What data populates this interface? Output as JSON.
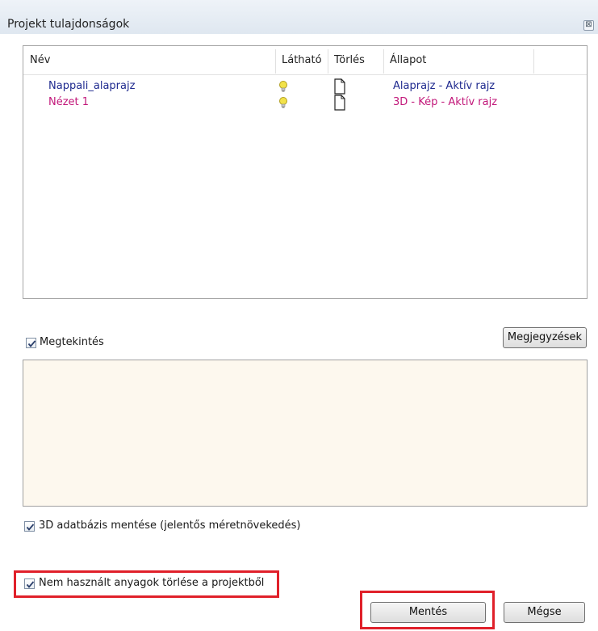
{
  "window": {
    "title": "Projekt tulajdonságok",
    "close_glyph": "⊠"
  },
  "list": {
    "columns": [
      "Név",
      "Látható",
      "Törlés",
      "Állapot"
    ],
    "rows": [
      {
        "name": "Nappali_alaprajz",
        "visible_icon": "lightbulb-icon",
        "delete_icon": "document-icon",
        "status": "Alaprajz - Aktív rajz",
        "color": "#1f2a8f"
      },
      {
        "name": "Nézet 1",
        "visible_icon": "lightbulb-icon",
        "delete_icon": "document-icon",
        "status": "3D - Kép - Aktív rajz",
        "color": "#c2187a"
      }
    ]
  },
  "preview": {
    "checkbox_label": "Megtekintés",
    "checked": true,
    "notes_button": "Megjegyzések"
  },
  "options": {
    "save_3d_db": {
      "label": "3D adatbázis mentése (jelentős méretnövekedés)",
      "checked": true
    },
    "delete_unused": {
      "label": "Nem használt anyagok törlése a projektből",
      "checked": true
    }
  },
  "buttons": {
    "save": "Mentés",
    "cancel": "Mégse"
  },
  "colors": {
    "highlight": "#e0202a",
    "preview_bg": "#fdf8ee"
  }
}
